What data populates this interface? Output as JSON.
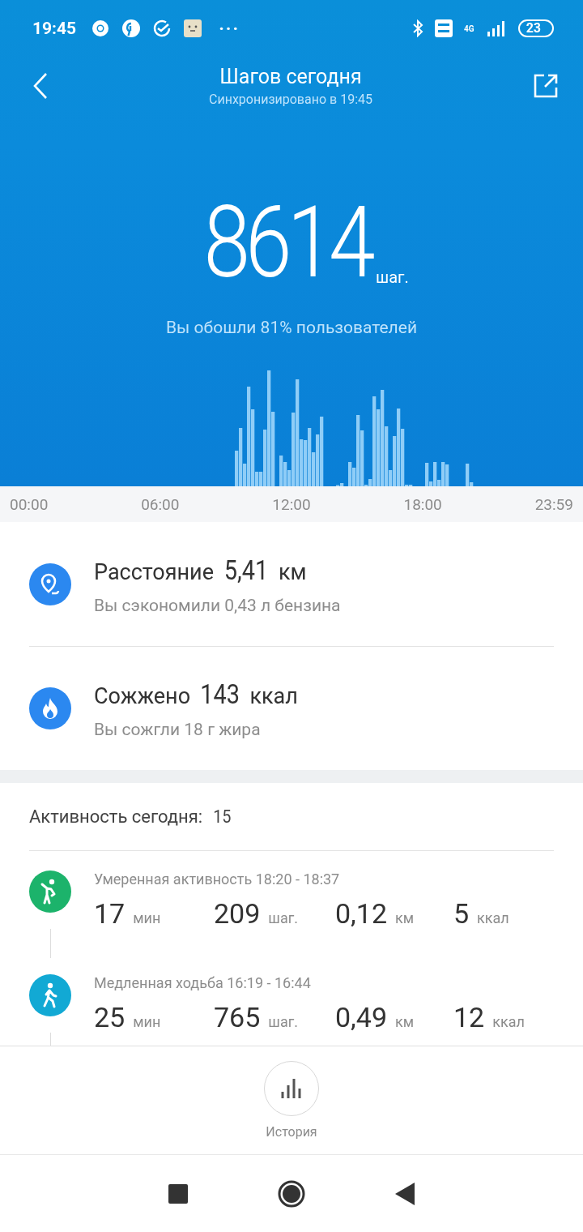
{
  "status_bar": {
    "time": "19:45",
    "more": "···",
    "network": "4G",
    "battery": "23"
  },
  "header": {
    "title": "Шагов сегодня",
    "subtitle": "Синхронизировано в 19:45"
  },
  "summary": {
    "steps": "8614",
    "unit": "шаг.",
    "comparison": "Вы обошли 81% пользователей"
  },
  "time_axis": [
    "00:00",
    "06:00",
    "12:00",
    "18:00",
    "23:59"
  ],
  "stats": [
    {
      "kind": "distance",
      "label": "Расстояние",
      "value": "5,41",
      "unit": "км",
      "note": "Вы сэкономили 0,43 л бензина"
    },
    {
      "kind": "calories",
      "label": "Сожжено",
      "value": "143",
      "unit": "ккал",
      "note": "Вы сожгли 18 г жира"
    }
  ],
  "activity": {
    "label": "Активность сегодня:",
    "count": "15",
    "items": [
      {
        "kind": "moderate",
        "color": "#1cb36b",
        "title": "Умеренная активность 18:20 - 18:37",
        "metrics": [
          {
            "value": "17",
            "unit": "мин"
          },
          {
            "value": "209",
            "unit": "шаг."
          },
          {
            "value": "0,12",
            "unit": "км"
          },
          {
            "value": "5",
            "unit": "ккал"
          }
        ]
      },
      {
        "kind": "walk",
        "color": "#12a9d4",
        "title": "Медленная ходьба 16:19 - 16:44",
        "metrics": [
          {
            "value": "25",
            "unit": "мин"
          },
          {
            "value": "765",
            "unit": "шаг."
          },
          {
            "value": "0,49",
            "unit": "км"
          },
          {
            "value": "12",
            "unit": "ккал"
          }
        ]
      }
    ]
  },
  "history_button": {
    "label": "История"
  }
}
